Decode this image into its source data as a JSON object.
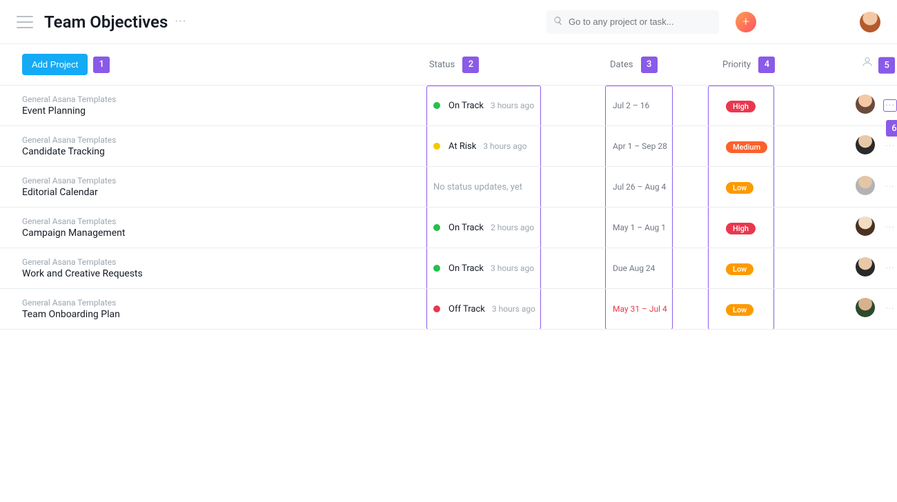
{
  "header": {
    "title": "Team Objectives",
    "search_placeholder": "Go to any project or task..."
  },
  "toolbar": {
    "add_project_label": "Add Project"
  },
  "columns": {
    "status": "Status",
    "dates": "Dates",
    "priority": "Priority"
  },
  "annotations": {
    "1": "1",
    "2": "2",
    "3": "3",
    "4": "4",
    "5": "5",
    "6": "6"
  },
  "status_colors": {
    "On Track": "#25c14a",
    "At Risk": "#f5c800",
    "Off Track": "#e8384f",
    "none": "transparent"
  },
  "priority_colors": {
    "High": "#e8384f",
    "Medium": "#fd612c",
    "Low": "#fd9a00"
  },
  "rows": [
    {
      "team": "General Asana Templates",
      "name": "Event Planning",
      "status_label": "On Track",
      "status_time": "3 hours ago",
      "dates": "Jul 2 – 16",
      "overdue": false,
      "priority": "High",
      "avatar": "av1",
      "show_actions_box": true
    },
    {
      "team": "General Asana Templates",
      "name": "Candidate Tracking",
      "status_label": "At Risk",
      "status_time": "3 hours ago",
      "dates": "Apr 1 – Sep 28",
      "overdue": false,
      "priority": "Medium",
      "avatar": "av2",
      "show_actions_box": false
    },
    {
      "team": "General Asana Templates",
      "name": "Editorial Calendar",
      "status_label": "No status updates, yet",
      "status_none": true,
      "status_time": "",
      "dates": "Jul 26 – Aug 4",
      "overdue": false,
      "priority": "Low",
      "avatar": "av3",
      "show_actions_box": false
    },
    {
      "team": "General Asana Templates",
      "name": "Campaign Management",
      "status_label": "On Track",
      "status_time": "2 hours ago",
      "dates": "May 1 – Aug 1",
      "overdue": false,
      "priority": "High",
      "avatar": "av4",
      "show_actions_box": false
    },
    {
      "team": "General Asana Templates",
      "name": "Work and Creative Requests",
      "status_label": "On Track",
      "status_time": "3 hours ago",
      "dates": "Due Aug 24",
      "overdue": false,
      "priority": "Low",
      "avatar": "av5",
      "show_actions_box": false
    },
    {
      "team": "General Asana Templates",
      "name": "Team Onboarding Plan",
      "status_label": "Off Track",
      "status_time": "3 hours ago",
      "dates": "May 31 – Jul 4",
      "overdue": true,
      "priority": "Low",
      "avatar": "av6",
      "show_actions_box": false
    }
  ]
}
